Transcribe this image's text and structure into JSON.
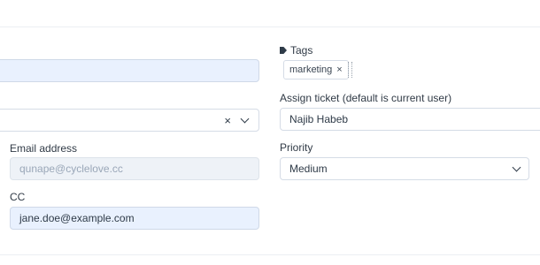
{
  "tags": {
    "label": "Tags",
    "items": [
      "marketing"
    ]
  },
  "assign": {
    "label": "Assign ticket (default is current user)",
    "value": "Najib Habeb"
  },
  "priority": {
    "label": "Priority",
    "value": "Medium"
  },
  "email": {
    "label": "Email address",
    "placeholder": "qunape@cyclelove.cc"
  },
  "cc": {
    "label": "CC",
    "value": "jane.doe@example.com"
  },
  "select_clear": "×",
  "tag_remove": "×",
  "icons": {
    "tags": "tag-icon",
    "chevron": "chevron-down-icon",
    "clear": "close-icon"
  }
}
